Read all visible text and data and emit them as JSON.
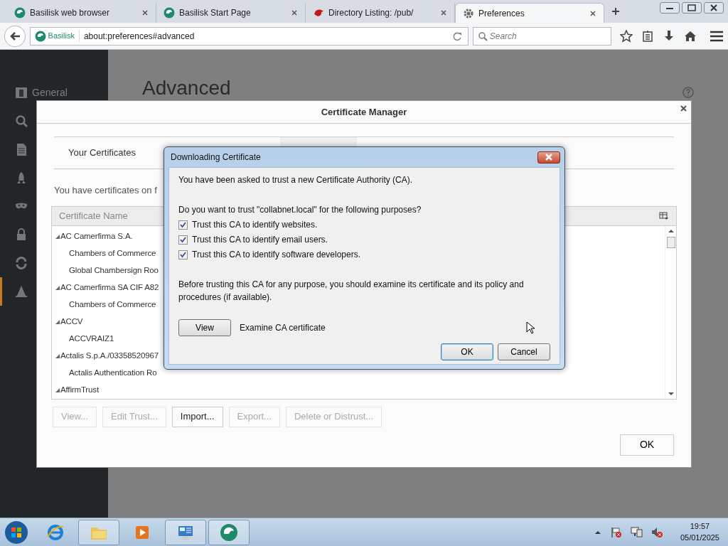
{
  "browser": {
    "tabs": [
      {
        "title": "Basilisk web browser",
        "kind": "basilisk",
        "selected": false
      },
      {
        "title": "Basilisk Start Page",
        "kind": "basilisk",
        "selected": false
      },
      {
        "title": "Directory Listing: /pub/",
        "kind": "bird",
        "selected": false
      },
      {
        "title": "Preferences",
        "kind": "gear",
        "selected": true
      }
    ],
    "identity": "Basilisk",
    "url": "about:preferences#advanced",
    "search": {
      "placeholder": "Search"
    }
  },
  "preferences": {
    "sidebar": [
      {
        "kind": "general",
        "label": "General",
        "selected": false
      },
      {
        "kind": "search",
        "selected": false
      },
      {
        "kind": "content",
        "selected": false
      },
      {
        "kind": "rocket",
        "selected": false
      },
      {
        "kind": "mask",
        "selected": false
      },
      {
        "kind": "lock",
        "selected": false
      },
      {
        "kind": "sync",
        "selected": false
      },
      {
        "kind": "hat",
        "selected": true
      }
    ],
    "heading": "Advanced"
  },
  "cert_manager": {
    "title": "Certificate Manager",
    "tabs": [
      {
        "label": "Your Certificates",
        "selected": false
      }
    ],
    "intro": "You have certificates on f",
    "columns": [
      "Certificate Name"
    ],
    "rows": [
      {
        "name": "AC Camerfirma S.A.",
        "expanded": true,
        "children": [
          {
            "name": "Chambers of Commerce"
          },
          {
            "name": "Global Chambersign Roo"
          }
        ]
      },
      {
        "name": "AC Camerfirma SA CIF A82",
        "expanded": true,
        "children": [
          {
            "name": "Chambers of Commerce"
          }
        ]
      },
      {
        "name": "ACCV",
        "expanded": true,
        "children": [
          {
            "name": "ACCVRAIZ1"
          }
        ]
      },
      {
        "name": "Actalis S.p.A./03358520967",
        "expanded": true,
        "children": [
          {
            "name": "Actalis Authentication Ro"
          }
        ]
      },
      {
        "name": "AffirmTrust",
        "expanded": true,
        "children": []
      }
    ],
    "buttons": [
      {
        "label": "View...",
        "disabled": true
      },
      {
        "label": "Edit Trust...",
        "disabled": true
      },
      {
        "label": "Import...",
        "disabled": false
      },
      {
        "label": "Export...",
        "disabled": true
      },
      {
        "label": "Delete or Distrust...",
        "disabled": true
      }
    ],
    "ok": "OK"
  },
  "dialog": {
    "title": "Downloading Certificate",
    "message": "You have been asked to trust a new Certificate Authority (CA).",
    "question": "Do you want to trust \"collabnet.local\" for the following purposes?",
    "options": [
      {
        "label": "Trust this CA to identify websites.",
        "checked": true
      },
      {
        "label": "Trust this CA to identify email users.",
        "checked": true
      },
      {
        "label": "Trust this CA to identify software developers.",
        "checked": true
      }
    ],
    "note": "Before trusting this CA for any purpose, you should examine its certificate and its policy and procedures (if available).",
    "view_button": "View",
    "view_caption": "Examine CA certificate",
    "buttons": [
      {
        "label": "OK",
        "default": true
      },
      {
        "label": "Cancel",
        "default": false
      }
    ]
  },
  "taskbar": {
    "apps": [
      {
        "kind": "ie",
        "open": false
      },
      {
        "kind": "folder",
        "open": true
      },
      {
        "kind": "media",
        "open": false
      },
      {
        "kind": "panel",
        "open": true
      },
      {
        "kind": "basilisk",
        "open": true
      }
    ],
    "clock": {
      "time": "19:57",
      "date": "05/01/2025"
    }
  }
}
